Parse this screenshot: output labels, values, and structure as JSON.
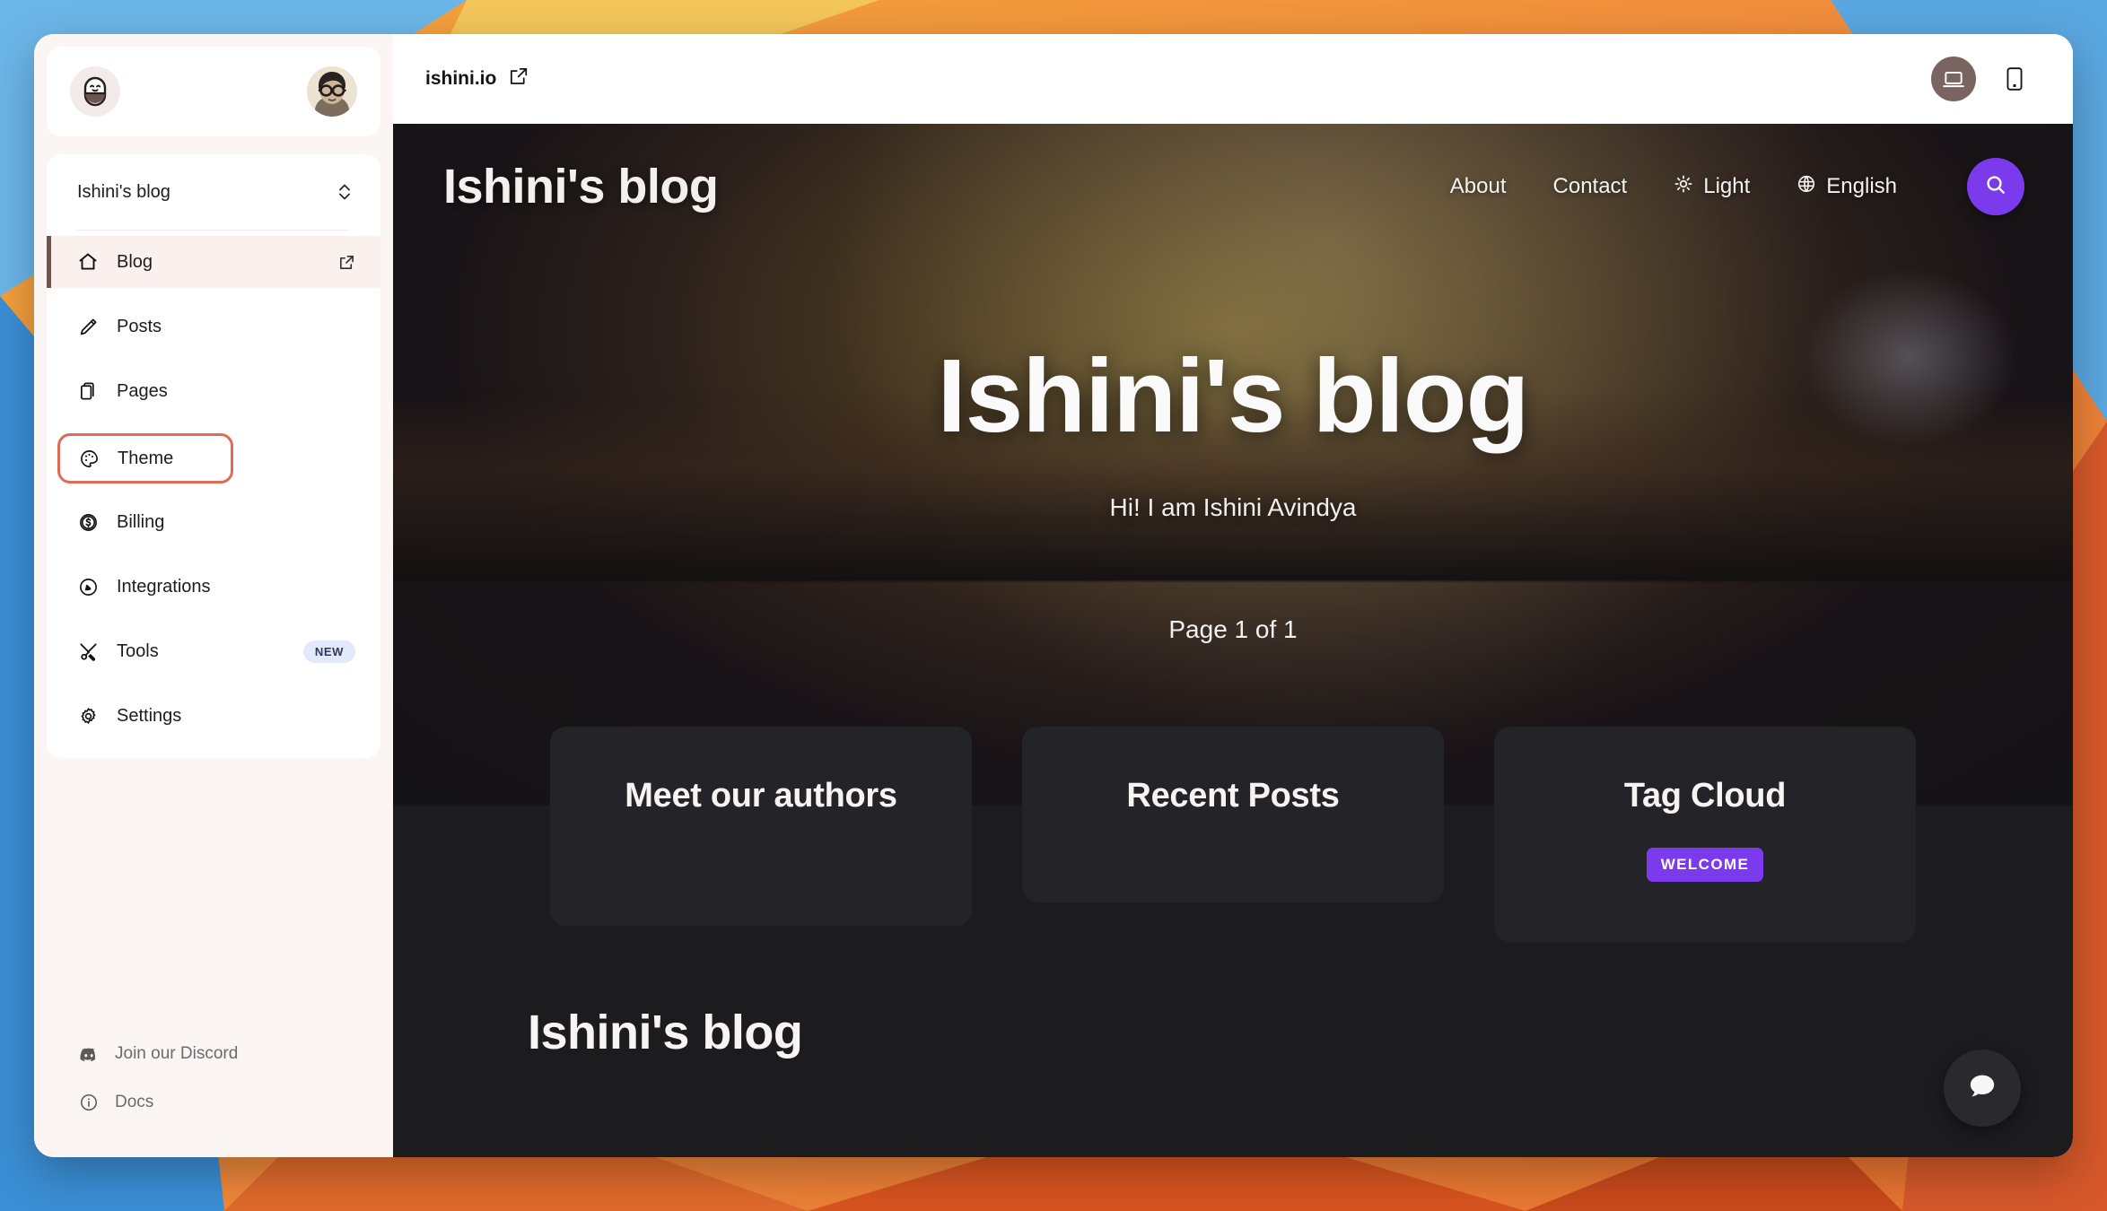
{
  "sidebar": {
    "logo_icon": "capsule-mascot-icon",
    "avatar_icon": "user-avatar",
    "site_selector": {
      "name": "Ishini's blog",
      "chevron_icon": "chevron-up-down-icon"
    },
    "items": [
      {
        "label": "Blog",
        "icon": "home-icon",
        "active": true,
        "external": true,
        "badge": ""
      },
      {
        "label": "Posts",
        "icon": "pencil-icon",
        "active": false,
        "external": false,
        "badge": ""
      },
      {
        "label": "Pages",
        "icon": "pages-icon",
        "active": false,
        "external": false,
        "badge": ""
      },
      {
        "label": "Theme",
        "icon": "palette-icon",
        "active": false,
        "external": false,
        "badge": ""
      },
      {
        "label": "Billing",
        "icon": "dollar-coin-icon",
        "active": false,
        "external": false,
        "badge": ""
      },
      {
        "label": "Integrations",
        "icon": "plug-icon",
        "active": false,
        "external": false,
        "badge": ""
      },
      {
        "label": "Tools",
        "icon": "tools-icon",
        "active": false,
        "external": false,
        "badge": "NEW"
      },
      {
        "label": "Settings",
        "icon": "gear-icon",
        "active": false,
        "external": false,
        "badge": ""
      }
    ],
    "footer": [
      {
        "label": "Join our Discord",
        "icon": "discord-icon"
      },
      {
        "label": "Docs",
        "icon": "info-icon"
      }
    ],
    "highlight_color": "#dd6c55",
    "active_accent": "#6f5550",
    "badge_bg": "#e4e8fb"
  },
  "toolbar": {
    "url": "ishini.io",
    "external_link_icon": "external-link-icon",
    "devices": [
      {
        "name": "desktop-view",
        "icon": "laptop-icon",
        "active": true
      },
      {
        "name": "mobile-view",
        "icon": "phone-icon",
        "active": false
      }
    ]
  },
  "site": {
    "brand": "Ishini's blog",
    "nav": [
      {
        "label": "About",
        "icon": ""
      },
      {
        "label": "Contact",
        "icon": ""
      },
      {
        "label": "Light",
        "icon": "sun-icon"
      },
      {
        "label": "English",
        "icon": "globe-icon"
      }
    ],
    "search_icon": "search-icon",
    "search_accent": "#7c3aed",
    "hero_title": "Ishini's blog",
    "hero_subtitle": "Hi! I am Ishini Avindya",
    "page_counter": "Page 1 of 1",
    "cards": [
      {
        "title": "Meet our authors",
        "tag": ""
      },
      {
        "title": "Recent Posts",
        "tag": ""
      },
      {
        "title": "Tag Cloud",
        "tag": "WELCOME"
      }
    ],
    "footer_brand": "Ishini's blog",
    "chat_icon": "chat-bubble-icon"
  }
}
